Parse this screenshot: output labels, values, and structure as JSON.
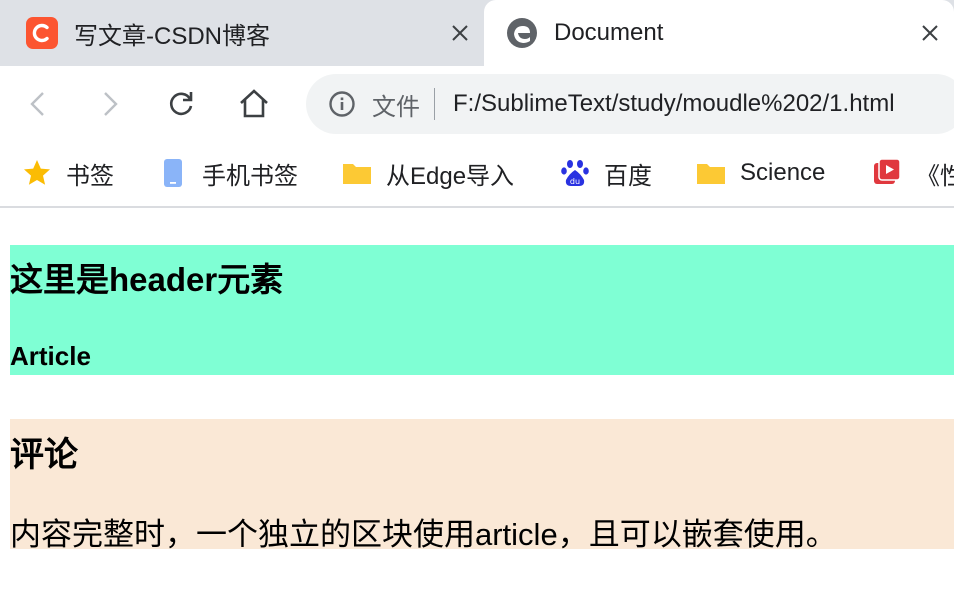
{
  "browser": {
    "tabs": [
      {
        "title": "写文章-CSDN博客",
        "icon": "csdn-logo-icon",
        "active": false
      },
      {
        "title": "Document",
        "icon": "edge-icon",
        "active": true
      }
    ],
    "address_bar": {
      "security_label": "文件",
      "url": "F:/SublimeText/study/moudle%202/1.html"
    },
    "bookmarks": [
      {
        "label": "书签",
        "icon": "star-icon"
      },
      {
        "label": "手机书签",
        "icon": "mobile-icon"
      },
      {
        "label": "从Edge导入",
        "icon": "folder-icon"
      },
      {
        "label": "百度",
        "icon": "baidu-paw-icon"
      },
      {
        "label": "Science",
        "icon": "folder-icon"
      },
      {
        "label": "《性",
        "icon": "video-icon"
      }
    ],
    "colors": {
      "tab_strip": "#dee1e6",
      "csdn_brand": "#fc5531",
      "star": "#fbbc04",
      "folder": "#fcc934",
      "baidu": "#2932e1",
      "video": "#e0383e"
    }
  },
  "page": {
    "header": {
      "title": "这里是header元素",
      "subtitle": "Article",
      "background": "#7fffd4"
    },
    "comment": {
      "title": "评论",
      "text": "内容完整时，一个独立的区块使用article，且可以嵌套使用。",
      "background": "#fae8d6"
    }
  }
}
